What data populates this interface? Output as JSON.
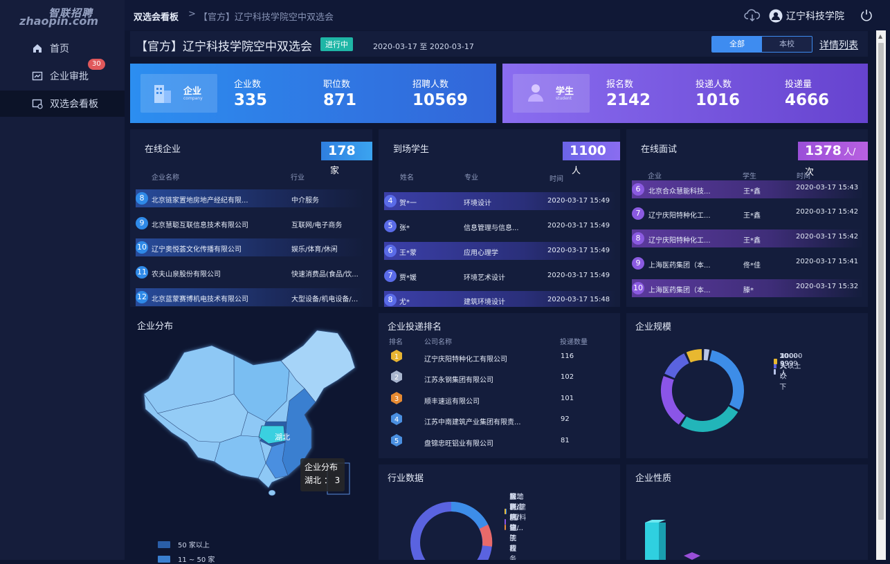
{
  "sidebar": {
    "logo_cn": "智联招聘",
    "logo_en": "zhaopin.com",
    "items": [
      {
        "label": "首页",
        "icon": "home-icon"
      },
      {
        "label": "企业审批",
        "icon": "chart-icon",
        "badge": "30"
      },
      {
        "label": "双选会看板",
        "icon": "board-icon"
      }
    ]
  },
  "header": {
    "breadcrumb_1": "双选会看板",
    "breadcrumb_sep": ">",
    "breadcrumb_2": "【官方】辽宁科技学院空中双选会",
    "user": "辽宁科技学院"
  },
  "fair": {
    "title": "【官方】辽宁科技学院空中双选会",
    "status": "进行中",
    "date_range": "2020-03-17 至 2020-03-17",
    "filter_all": "全部",
    "filter_school": "本校",
    "detail_link": "详情列表"
  },
  "company_stats": {
    "label": "企业",
    "sub": "company",
    "items": [
      {
        "label": "企业数",
        "value": "335"
      },
      {
        "label": "职位数",
        "value": "871"
      },
      {
        "label": "招聘人数",
        "value": "10569"
      }
    ]
  },
  "student_stats": {
    "label": "学生",
    "sub": "student",
    "items": [
      {
        "label": "报名数",
        "value": "2142"
      },
      {
        "label": "投递人数",
        "value": "1016"
      },
      {
        "label": "投递量",
        "value": "4666"
      }
    ]
  },
  "online_companies": {
    "title": "在线企业",
    "count": "178",
    "unit": "家",
    "col_name": "企业名称",
    "col_industry": "行业",
    "rows": [
      {
        "n": "8",
        "name": "北京链家置地房地产经纪有限...",
        "industry": "中介服务"
      },
      {
        "n": "9",
        "name": "北京慧聪互联信息技术有限公司",
        "industry": "互联网/电子商务"
      },
      {
        "n": "10",
        "name": "辽宁奥悦荟文化传播有限公司",
        "industry": "娱乐/体育/休闲"
      },
      {
        "n": "11",
        "name": "农夫山泉股份有限公司",
        "industry": "快速消费品(食品/饮..."
      },
      {
        "n": "12",
        "name": "北京蓝蒙赛博机电技术有限公司",
        "industry": "大型设备/机电设备/..."
      }
    ]
  },
  "arrived_students": {
    "title": "到场学生",
    "count": "1100",
    "unit": "人",
    "col_name": "姓名",
    "col_major": "专业",
    "col_time": "时间",
    "rows": [
      {
        "n": "4",
        "name": "贺*一",
        "major": "环境设计",
        "time": "2020-03-17 15:49"
      },
      {
        "n": "5",
        "name": "张*",
        "major": "信息管理与信息...",
        "time": "2020-03-17 15:49"
      },
      {
        "n": "6",
        "name": "王*蒙",
        "major": "应用心理学",
        "time": "2020-03-17 15:49"
      },
      {
        "n": "7",
        "name": "贾*媛",
        "major": "环境艺术设计",
        "time": "2020-03-17 15:49"
      },
      {
        "n": "8",
        "name": "尤*",
        "major": "建筑环境设计",
        "time": "2020-03-17 15:48"
      }
    ]
  },
  "online_interviews": {
    "title": "在线面试",
    "count": "1378",
    "unit": "人/次",
    "col_company": "企业",
    "col_student": "学生",
    "col_time": "时间",
    "rows": [
      {
        "n": "6",
        "company": "北京合众慧能科技...",
        "student": "王*鑫",
        "time": "2020-03-17 15:43"
      },
      {
        "n": "7",
        "company": "辽宁庆阳特种化工...",
        "student": "王*鑫",
        "time": "2020-03-17 15:42"
      },
      {
        "n": "8",
        "company": "辽宁庆阳特种化工...",
        "student": "王*鑫",
        "time": "2020-03-17 15:42"
      },
      {
        "n": "9",
        "company": "上海医药集团（本...",
        "student": "佟*佳",
        "time": "2020-03-17 15:41"
      },
      {
        "n": "10",
        "company": "上海医药集团（本...",
        "student": "滕*",
        "time": "2020-03-17 15:32"
      }
    ]
  },
  "company_map": {
    "title": "企业分布",
    "highlight": "湖北",
    "tooltip_title": "企业分布",
    "tooltip_text": "湖北 ： 3",
    "legend": [
      {
        "label": "50 家以上",
        "color": "#2a5ea8"
      },
      {
        "label": "11 ~ 50 家",
        "color": "#3a7fd0"
      }
    ]
  },
  "delivery_rank": {
    "title": "企业投递排名",
    "col_rank": "排名",
    "col_name": "公司名称",
    "col_count": "投递数量",
    "rows": [
      {
        "rank": "1",
        "name": "辽宁庆阳特种化工有限公司",
        "count": "116",
        "color": "#e7b432"
      },
      {
        "rank": "2",
        "name": "江苏永钢集团有限公司",
        "count": "102",
        "color": "#a9b6cf"
      },
      {
        "rank": "3",
        "name": "顺丰速运有限公司",
        "count": "101",
        "color": "#e68a32"
      },
      {
        "rank": "4",
        "name": "江苏中南建筑产业集团有限责...",
        "count": "92",
        "color": "#4a8fe0"
      },
      {
        "rank": "5",
        "name": "盘锦忠旺铝业有限公司",
        "count": "81",
        "color": "#4a8fe0"
      }
    ]
  },
  "company_size": {
    "title": "企业规模",
    "legend": [
      {
        "label": "100-499人",
        "color": "#3d8de8"
      },
      {
        "label": "1000-9999人",
        "color": "#22b5b9"
      },
      {
        "label": "20-99人",
        "color": "#8b55e8"
      },
      {
        "label": "500-999人",
        "color": "#5a63e0"
      },
      {
        "label": "10000人以上",
        "color": "#e8b830"
      },
      {
        "label": "20人以下",
        "color": "#b8c4e8"
      }
    ],
    "values": [
      30,
      26,
      22,
      12,
      7,
      3
    ]
  },
  "industry_data": {
    "title": "行业数据",
    "legend": [
      {
        "label": "房地产/建筑/建...",
        "color": "#3d8de8"
      },
      {
        "label": "教育/培训/院校",
        "color": "#e86a6a"
      },
      {
        "label": "医药/生物工程",
        "color": "#8b55e8"
      },
      {
        "label": "加工制造(原料加...",
        "color": "#e8b830"
      },
      {
        "label": "互联网/电子商务",
        "color": "#e88a3a"
      }
    ]
  },
  "company_nature": {
    "title": "企业性质"
  }
}
